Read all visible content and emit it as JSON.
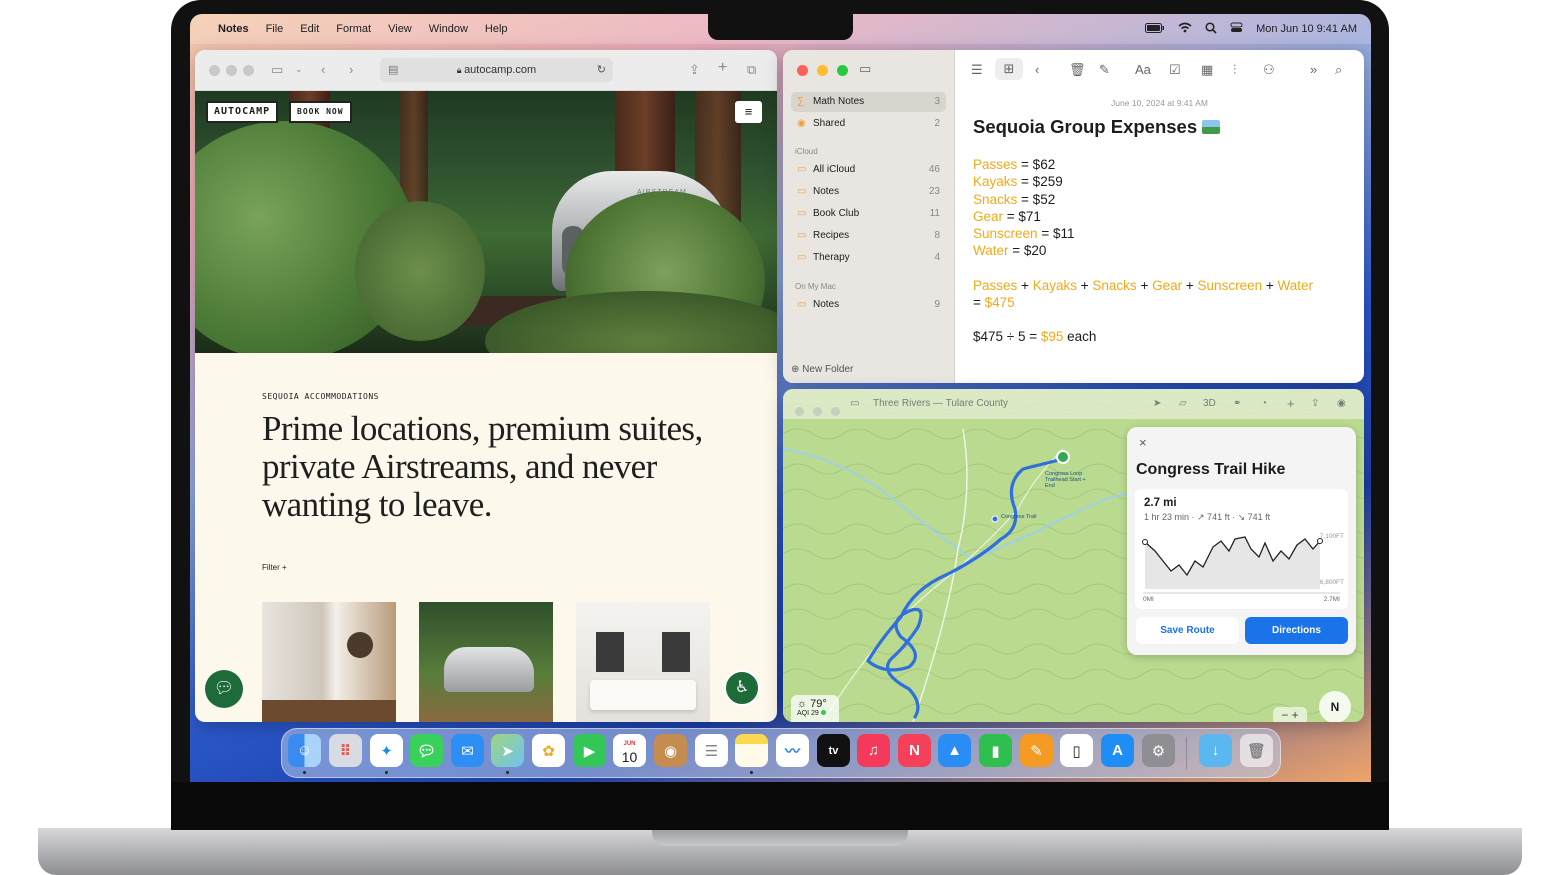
{
  "menubar": {
    "app_name": "Notes",
    "menus": [
      "File",
      "Edit",
      "Format",
      "View",
      "Window",
      "Help"
    ],
    "datetime": "Mon Jun 10  9:41 AM"
  },
  "safari": {
    "url": "autocamp.com",
    "brand_label": "AUTOCAMP",
    "book_label": "BOOK NOW",
    "trailer_text": "AIRSTREAM",
    "eyebrow": "SEQUOIA ACCOMMODATIONS",
    "headline": "Prime locations, premium suites, private Airstreams, and never wanting to leave.",
    "filter_label": "Filter +"
  },
  "notes": {
    "sidebar": {
      "pinned": [
        {
          "label": "Math Notes",
          "count": "3"
        },
        {
          "label": "Shared",
          "count": "2"
        }
      ],
      "icloud_header": "iCloud",
      "icloud": [
        {
          "label": "All iCloud",
          "count": "46"
        },
        {
          "label": "Notes",
          "count": "23"
        },
        {
          "label": "Book Club",
          "count": "11"
        },
        {
          "label": "Recipes",
          "count": "8"
        },
        {
          "label": "Therapy",
          "count": "4"
        }
      ],
      "mac_header": "On My Mac",
      "mac": [
        {
          "label": "Notes",
          "count": "9"
        }
      ],
      "new_folder": "New Folder"
    },
    "note": {
      "date": "June 10, 2024 at 9:41 AM",
      "title": "Sequoia Group Expenses",
      "lines": [
        {
          "name": "Passes",
          "value": "= $62"
        },
        {
          "name": "Kayaks",
          "value": "= $259"
        },
        {
          "name": "Snacks",
          "value": "= $52"
        },
        {
          "name": "Gear",
          "value": "= $71"
        },
        {
          "name": "Sunscreen",
          "value": "= $11"
        },
        {
          "name": "Water",
          "value": "= $20"
        }
      ],
      "sum_terms": [
        "Passes",
        "Kayaks",
        "Snacks",
        "Gear",
        "Sunscreen",
        "Water"
      ],
      "plus": "+",
      "sum_prefix": "=",
      "sum_result": "$475",
      "divide_expr": "$475 ÷ 5 =",
      "divide_result": "$95",
      "divide_suffix": "each"
    }
  },
  "maps": {
    "title": "Three Rivers — Tulare County",
    "toolbar_3d": "3D",
    "trailhead_label": "Congress Loop Trailhead Start + End",
    "waypoint_label": "Congress Trail",
    "card": {
      "title": "Congress Trail Hike",
      "distance": "2.7 mi",
      "stats": "1 hr 23 min · ↗ 741 ft · ↘ 741 ft",
      "elev_high": "7,100FT",
      "elev_low": "6,800FT",
      "x_start": "0MI",
      "x_end": "2.7MI",
      "save_label": "Save Route",
      "directions_label": "Directions"
    },
    "weather_temp": "79°",
    "weather_aqi": "AQI 29",
    "compass": "N"
  },
  "dock": {
    "calendar_month": "JUN",
    "calendar_day": "10",
    "apps": [
      "finder",
      "launchpad",
      "safari",
      "messages",
      "mail",
      "maps",
      "photos",
      "facetime",
      "calendar",
      "contacts",
      "reminders",
      "notes",
      "freeform",
      "tv",
      "music",
      "news",
      "keynote",
      "numbers",
      "pages",
      "iphone-mirroring",
      "app-store",
      "system-settings",
      "downloads",
      "trash"
    ]
  },
  "colors": {
    "notes_accent": "#f2a916",
    "maps_blue": "#1a73e8",
    "trail_blue": "#2f6fe0",
    "fab_green": "#1e6b3a"
  }
}
